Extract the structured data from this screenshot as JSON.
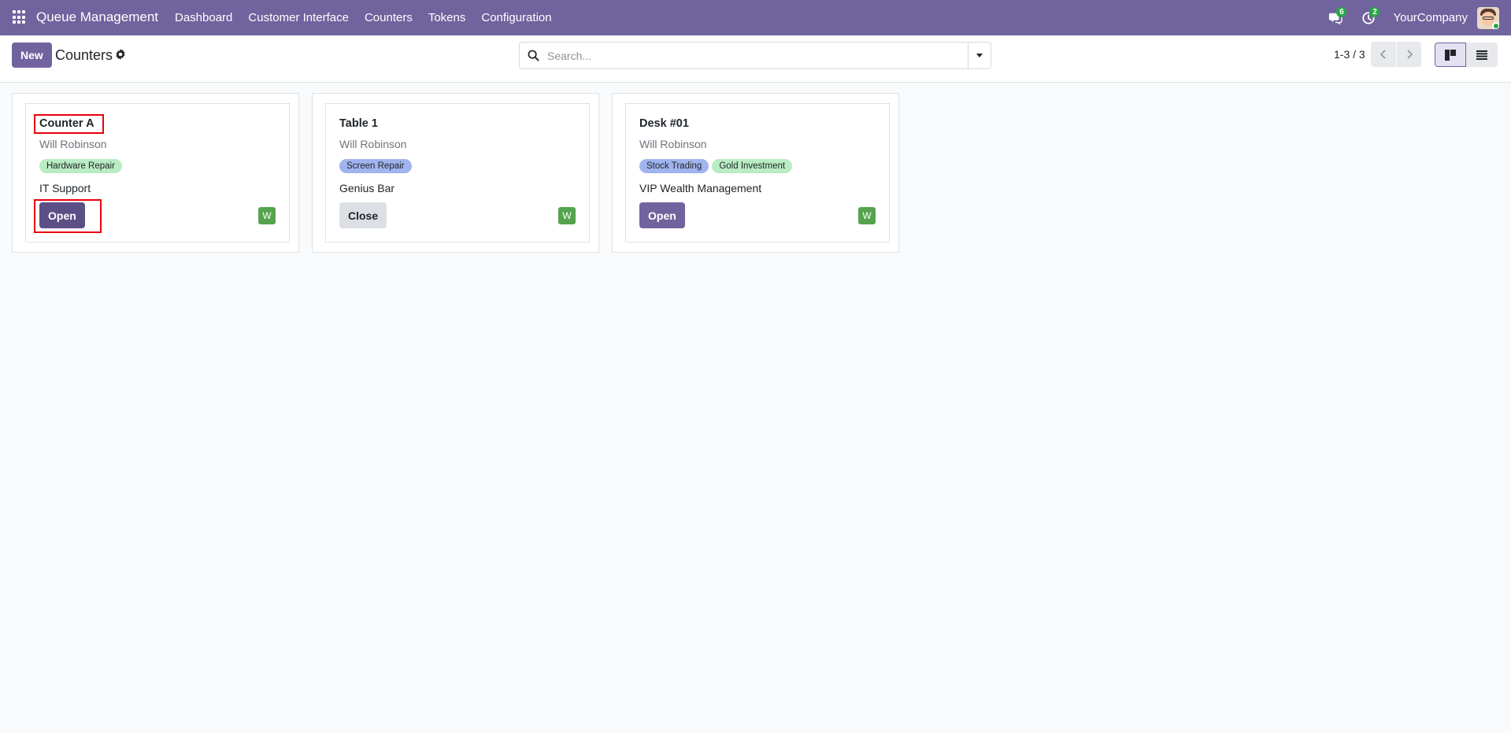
{
  "navbar": {
    "brand": "Queue Management",
    "menu": [
      {
        "label": "Dashboard"
      },
      {
        "label": "Customer Interface"
      },
      {
        "label": "Counters"
      },
      {
        "label": "Tokens"
      },
      {
        "label": "Configuration"
      }
    ],
    "messages_count": "6",
    "activities_count": "2",
    "company": "YourCompany",
    "accent_color": "#71639e"
  },
  "control_panel": {
    "new_label": "New",
    "title": "Counters",
    "search_placeholder": "Search...",
    "pager": "1-3 / 3"
  },
  "cards": [
    {
      "title": "Counter A",
      "user": "Will Robinson",
      "tags": [
        "Hardware Repair"
      ],
      "location": "IT Support",
      "button": "Open",
      "avatar": "W"
    },
    {
      "title": "Table 1",
      "user": "Will Robinson",
      "tags": [
        "Screen Repair"
      ],
      "location": "Genius Bar",
      "button": "Close",
      "avatar": "W"
    },
    {
      "title": "Desk #01",
      "user": "Will Robinson",
      "tags": [
        "Stock Trading",
        "Gold Investment"
      ],
      "location": "VIP Wealth Management",
      "button": "Open",
      "avatar": "W"
    }
  ]
}
